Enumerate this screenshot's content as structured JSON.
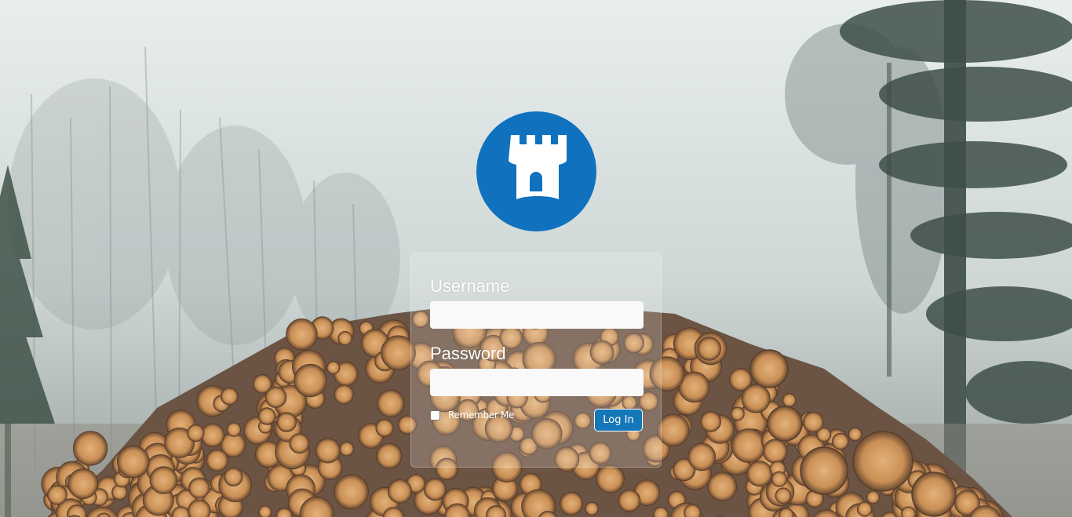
{
  "logo": {
    "icon": "castle-tower-icon",
    "color": "#1072be"
  },
  "login_form": {
    "username_label": "Username",
    "username_value": "",
    "password_label": "Password",
    "password_value": "",
    "remember_label": "Remember Me",
    "remember_checked": false,
    "submit_label": "Log In"
  },
  "background": {
    "scene": "foggy-forest-with-log-pile"
  },
  "colors": {
    "accent": "#1477b8",
    "logo_background": "#1072be"
  }
}
